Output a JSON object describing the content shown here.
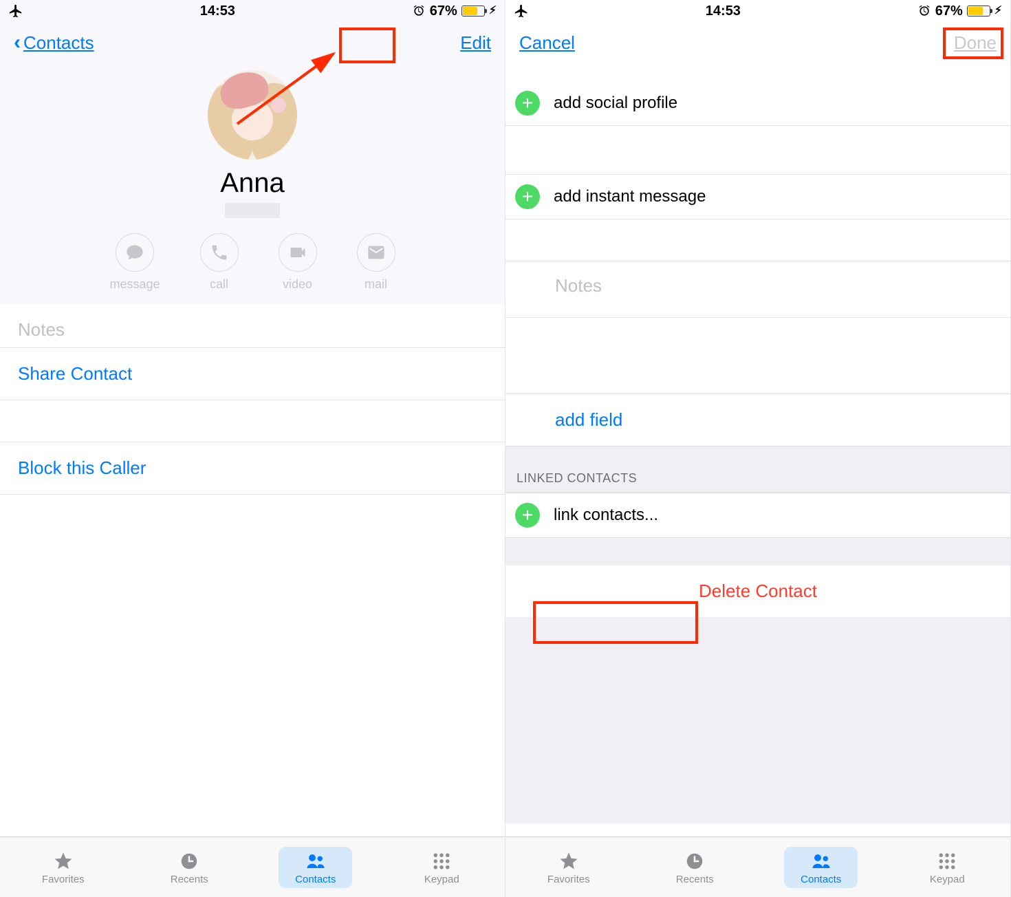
{
  "status": {
    "time": "14:53",
    "battery_pct": "67%"
  },
  "left": {
    "nav_back": "Contacts",
    "nav_edit": "Edit",
    "contact_name": "Anna",
    "actions": {
      "message": "message",
      "call": "call",
      "video": "video",
      "mail": "mail"
    },
    "notes_label": "Notes",
    "share": "Share Contact",
    "block": "Block this Caller"
  },
  "right": {
    "nav_cancel": "Cancel",
    "nav_done": "Done",
    "add_social": "add social profile",
    "add_im": "add instant message",
    "notes_label": "Notes",
    "add_field": "add field",
    "linked_header": "LINKED CONTACTS",
    "link_contacts": "link contacts...",
    "delete": "Delete Contact"
  },
  "tabs": {
    "favorites": "Favorites",
    "recents": "Recents",
    "contacts": "Contacts",
    "keypad": "Keypad"
  }
}
